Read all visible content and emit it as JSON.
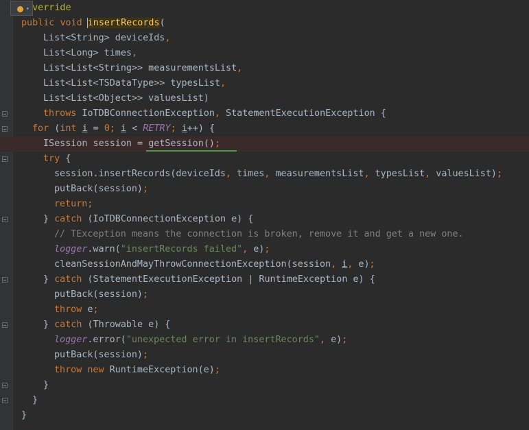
{
  "editor": {
    "lines": [
      {
        "tokens": [
          {
            "t": "@Override",
            "c": "ann"
          }
        ]
      },
      {
        "tokens": [
          {
            "t": "public ",
            "c": "kw"
          },
          {
            "t": "void ",
            "c": "kw"
          },
          {
            "t": "insertRecords",
            "c": "fn hl-method"
          },
          {
            "t": "(",
            "c": ""
          }
        ]
      },
      {
        "tokens": [
          {
            "t": "List<String> deviceIds",
            "c": ""
          },
          {
            "t": ",",
            "c": "kw"
          }
        ]
      },
      {
        "tokens": [
          {
            "t": "List<Long> times",
            "c": ""
          },
          {
            "t": ",",
            "c": "kw"
          }
        ]
      },
      {
        "tokens": [
          {
            "t": "List<List<String>> measurementsList",
            "c": ""
          },
          {
            "t": ",",
            "c": "kw"
          }
        ]
      },
      {
        "tokens": [
          {
            "t": "List<List<TSDataType>> typesList",
            "c": ""
          },
          {
            "t": ",",
            "c": "kw"
          }
        ]
      },
      {
        "tokens": [
          {
            "t": "List<List<Object>> valuesList)",
            "c": ""
          }
        ]
      },
      {
        "tokens": [
          {
            "t": "throws ",
            "c": "kw"
          },
          {
            "t": "IoTDBConnectionException",
            "c": ""
          },
          {
            "t": ", ",
            "c": "kw"
          },
          {
            "t": "StatementExecutionException {",
            "c": ""
          }
        ]
      },
      {
        "tokens": [
          {
            "t": "for ",
            "c": "kw"
          },
          {
            "t": "(",
            "c": ""
          },
          {
            "t": "int ",
            "c": "kw"
          },
          {
            "t": "i",
            "c": "ul"
          },
          {
            "t": " = ",
            "c": ""
          },
          {
            "t": "0",
            "c": "kw"
          },
          {
            "t": "; ",
            "c": "kw"
          },
          {
            "t": "i",
            "c": "ul"
          },
          {
            "t": " < ",
            "c": ""
          },
          {
            "t": "RETRY",
            "c": "it"
          },
          {
            "t": "; ",
            "c": "kw"
          },
          {
            "t": "i",
            "c": "ul"
          },
          {
            "t": "++) {",
            "c": ""
          }
        ]
      },
      {
        "tokens": [
          {
            "t": "ISession session = ",
            "c": ""
          },
          {
            "t": "getSession",
            "c": ""
          },
          {
            "t": "()",
            "c": ""
          },
          {
            "t": ";",
            "c": "kw"
          }
        ]
      },
      {
        "tokens": [
          {
            "t": "try ",
            "c": "kw"
          },
          {
            "t": "{",
            "c": ""
          }
        ]
      },
      {
        "tokens": [
          {
            "t": "session.insertRecords(deviceIds",
            "c": ""
          },
          {
            "t": ", ",
            "c": "kw"
          },
          {
            "t": "times",
            "c": ""
          },
          {
            "t": ", ",
            "c": "kw"
          },
          {
            "t": "measurementsList",
            "c": ""
          },
          {
            "t": ", ",
            "c": "kw"
          },
          {
            "t": "typesList",
            "c": ""
          },
          {
            "t": ", ",
            "c": "kw"
          },
          {
            "t": "valuesList)",
            "c": ""
          },
          {
            "t": ";",
            "c": "kw"
          }
        ]
      },
      {
        "tokens": [
          {
            "t": "putBack(session)",
            "c": ""
          },
          {
            "t": ";",
            "c": "kw"
          }
        ]
      },
      {
        "tokens": [
          {
            "t": "return;",
            "c": "kw"
          }
        ]
      },
      {
        "tokens": [
          {
            "t": "} ",
            "c": ""
          },
          {
            "t": "catch ",
            "c": "kw"
          },
          {
            "t": "(IoTDBConnectionException e) {",
            "c": ""
          }
        ]
      },
      {
        "tokens": [
          {
            "t": "// TException means the connection is broken, remove it and get a new one.",
            "c": "cmt"
          }
        ]
      },
      {
        "tokens": [
          {
            "t": "logger",
            "c": "field-it"
          },
          {
            "t": ".warn(",
            "c": ""
          },
          {
            "t": "\"insertRecords failed\"",
            "c": "str"
          },
          {
            "t": ", ",
            "c": "kw"
          },
          {
            "t": "e)",
            "c": ""
          },
          {
            "t": ";",
            "c": "kw"
          }
        ]
      },
      {
        "tokens": [
          {
            "t": "cleanSessionAndMayThrowConnectionException(session",
            "c": ""
          },
          {
            "t": ", ",
            "c": "kw"
          },
          {
            "t": "i",
            "c": "ul"
          },
          {
            "t": ", ",
            "c": "kw"
          },
          {
            "t": "e)",
            "c": ""
          },
          {
            "t": ";",
            "c": "kw"
          }
        ]
      },
      {
        "tokens": [
          {
            "t": "} ",
            "c": ""
          },
          {
            "t": "catch ",
            "c": "kw"
          },
          {
            "t": "(StatementExecutionException | RuntimeException e) {",
            "c": ""
          }
        ]
      },
      {
        "tokens": [
          {
            "t": "putBack(session)",
            "c": ""
          },
          {
            "t": ";",
            "c": "kw"
          }
        ]
      },
      {
        "tokens": [
          {
            "t": "throw ",
            "c": "kw"
          },
          {
            "t": "e",
            "c": ""
          },
          {
            "t": ";",
            "c": "kw"
          }
        ]
      },
      {
        "tokens": [
          {
            "t": "} ",
            "c": ""
          },
          {
            "t": "catch ",
            "c": "kw"
          },
          {
            "t": "(Throwable e) {",
            "c": ""
          }
        ]
      },
      {
        "tokens": [
          {
            "t": "logger",
            "c": "field-it"
          },
          {
            "t": ".error(",
            "c": ""
          },
          {
            "t": "\"unexpected error in insertRecords\"",
            "c": "str"
          },
          {
            "t": ", ",
            "c": "kw"
          },
          {
            "t": "e)",
            "c": ""
          },
          {
            "t": ";",
            "c": "kw"
          }
        ]
      },
      {
        "tokens": [
          {
            "t": "putBack(session)",
            "c": ""
          },
          {
            "t": ";",
            "c": "kw"
          }
        ]
      },
      {
        "tokens": [
          {
            "t": "throw ",
            "c": "kw"
          },
          {
            "t": "new ",
            "c": "kw"
          },
          {
            "t": "RuntimeException(e)",
            "c": ""
          },
          {
            "t": ";",
            "c": "kw"
          }
        ]
      },
      {
        "tokens": [
          {
            "t": "}",
            "c": ""
          }
        ]
      },
      {
        "tokens": [
          {
            "t": "}",
            "c": ""
          }
        ]
      },
      {
        "tokens": [
          {
            "t": "}",
            "c": ""
          }
        ]
      }
    ]
  },
  "intention_bulb": {
    "icon": "lightbulb-icon",
    "color": "#e8a33d"
  },
  "colors": {
    "background": "#2b2b2b",
    "keyword": "#cc7832",
    "string": "#6a8759",
    "comment": "#808080",
    "annotation": "#bbb529",
    "method": "#ffc66d",
    "field": "#9876aa",
    "error_line": "#3b2a2a"
  }
}
